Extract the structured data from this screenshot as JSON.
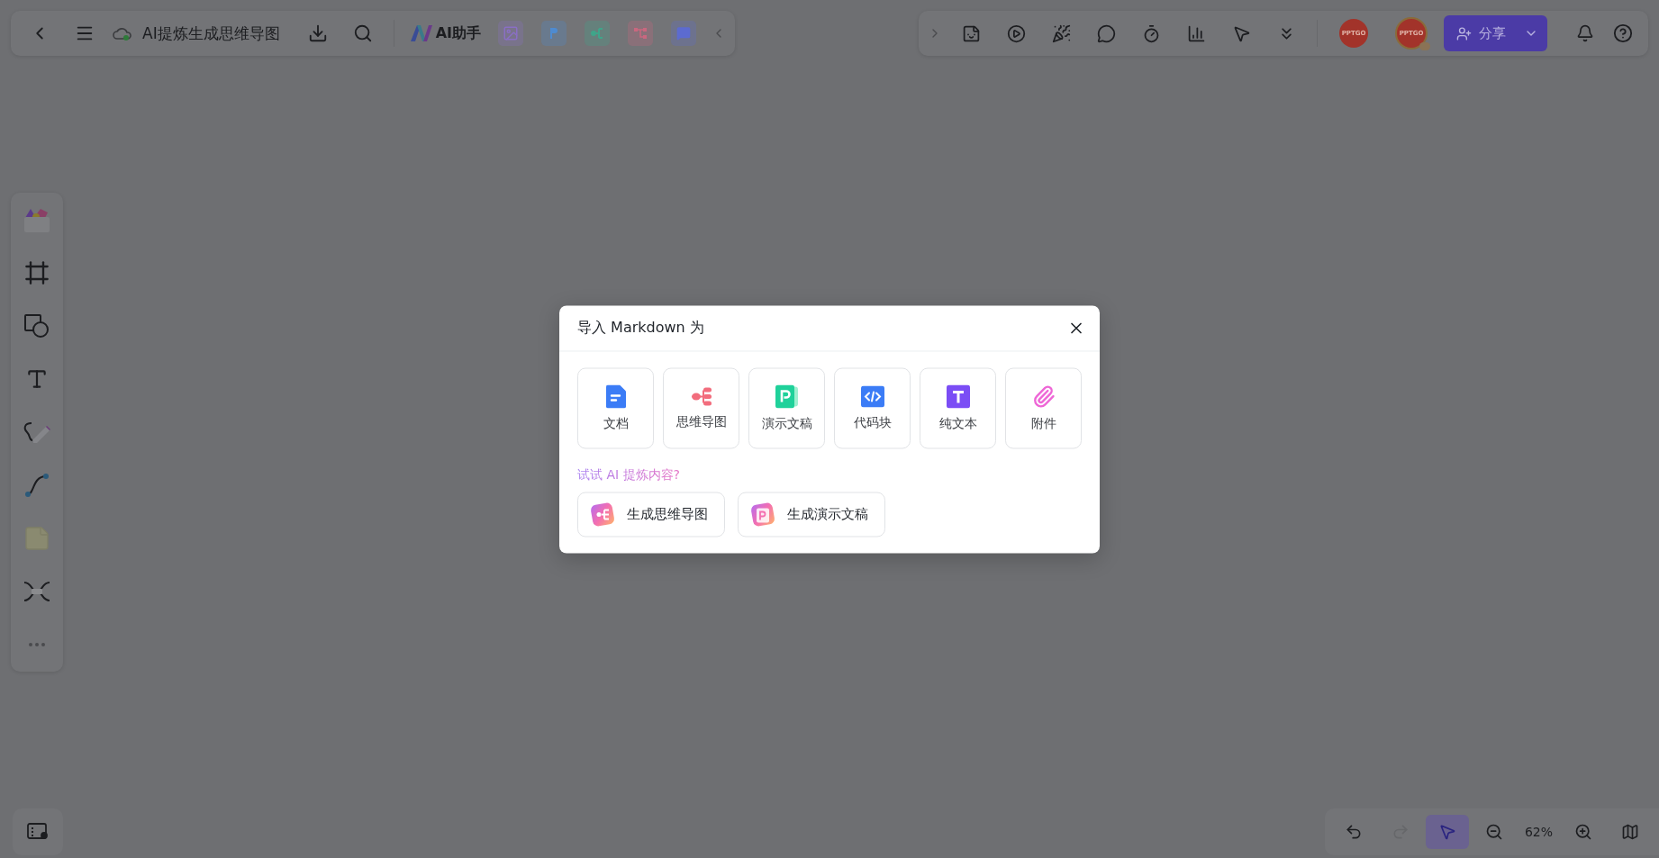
{
  "top_left_toolbar": {
    "items": [
      {
        "kind": "back"
      },
      {
        "kind": "menu"
      },
      {
        "kind": "cloud"
      }
    ],
    "document_title": "AI提炼生成思维导图",
    "actions": [
      {
        "kind": "download"
      },
      {
        "kind": "search"
      }
    ],
    "ai_assistant": "AI助手",
    "apps": [
      {
        "kind": "image",
        "color": "#8a6fc4"
      },
      {
        "kind": "slides",
        "color": "#4e8bd0"
      },
      {
        "kind": "mindmap",
        "color": "#3fa58a"
      },
      {
        "kind": "flow",
        "color": "#c9677f"
      },
      {
        "kind": "chat",
        "color": "#5c6bd0"
      }
    ]
  },
  "top_right_toolbar": {
    "tools": [
      {
        "kind": "sticker"
      },
      {
        "kind": "play"
      },
      {
        "kind": "party"
      },
      {
        "kind": "comment"
      },
      {
        "kind": "timer"
      },
      {
        "kind": "chart"
      },
      {
        "kind": "laser"
      },
      {
        "kind": "more"
      }
    ],
    "avatars": [
      {
        "label": "PPTGO",
        "badge": false
      },
      {
        "label": "PPTGO",
        "badge": true
      }
    ],
    "share_button": "分享"
  },
  "sidebar": {
    "tools": [
      {
        "kind": "library"
      },
      {
        "kind": "frame"
      },
      {
        "kind": "shape"
      },
      {
        "kind": "text"
      },
      {
        "kind": "pen"
      },
      {
        "kind": "connector"
      },
      {
        "kind": "sticky"
      },
      {
        "kind": "mindmap"
      },
      {
        "kind": "more"
      }
    ]
  },
  "dialog": {
    "title": "导入 Markdown 为",
    "options": [
      {
        "kind": "doc",
        "label": "文档"
      },
      {
        "kind": "mindmap",
        "label": "思维导图"
      },
      {
        "kind": "slides",
        "label": "演示文稿"
      },
      {
        "kind": "code",
        "label": "代码块"
      },
      {
        "kind": "text",
        "label": "纯文本"
      },
      {
        "kind": "attachment",
        "label": "附件"
      }
    ],
    "ai_hint": "试试 AI 提炼内容?",
    "ai_actions": [
      {
        "kind": "mindmap",
        "label": "生成思维导图"
      },
      {
        "kind": "slides",
        "label": "生成演示文稿"
      }
    ]
  },
  "bottom_bar": {
    "items": [
      {
        "kind": "undo",
        "disabled": false,
        "selected": false
      },
      {
        "kind": "redo",
        "disabled": true,
        "selected": false
      },
      {
        "kind": "pointer",
        "disabled": false,
        "selected": true
      },
      {
        "kind": "zoom_out",
        "disabled": false,
        "selected": false
      },
      {
        "kind": "zoom_level",
        "label": "62%",
        "disabled": false,
        "selected": false
      },
      {
        "kind": "zoom_in",
        "disabled": false,
        "selected": false
      },
      {
        "kind": "map",
        "disabled": false,
        "selected": false
      }
    ]
  }
}
